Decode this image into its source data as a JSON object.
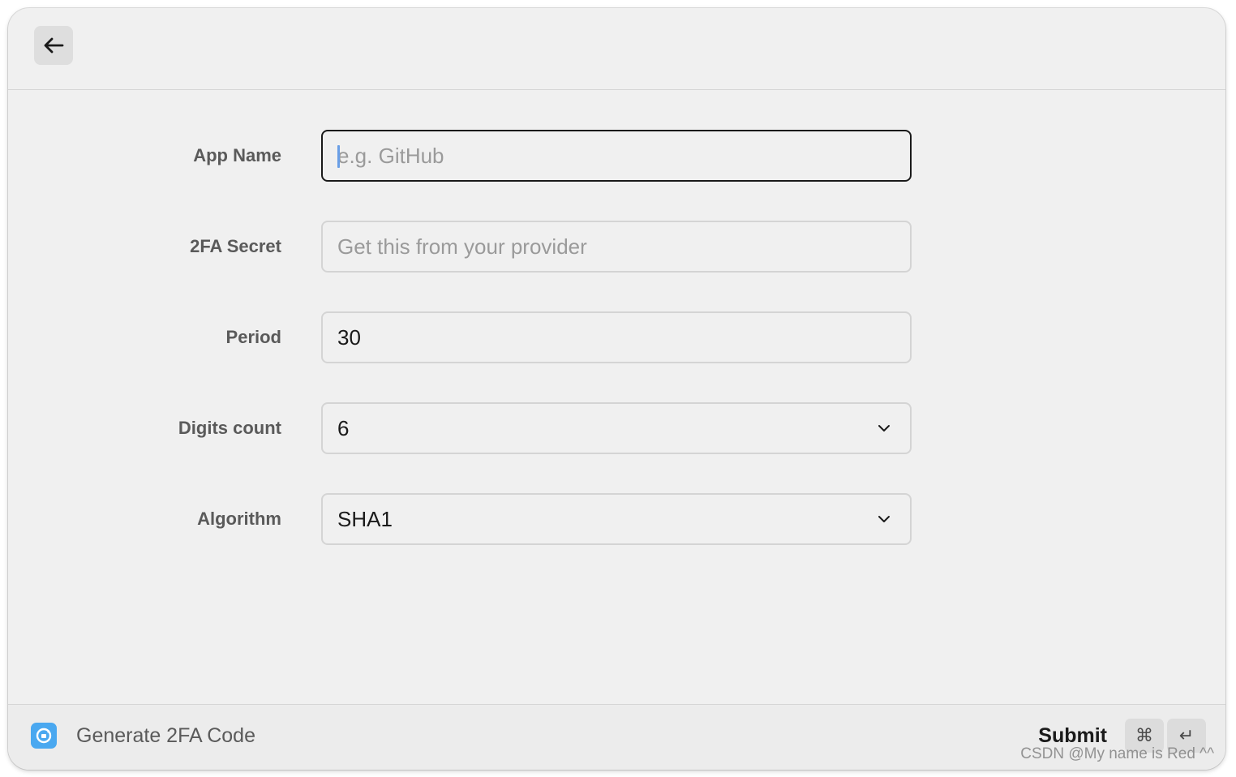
{
  "header": {
    "back_icon": "arrow-left-icon"
  },
  "form": {
    "app_name": {
      "label": "App Name",
      "placeholder": "e.g. GitHub",
      "value": ""
    },
    "secret": {
      "label": "2FA Secret",
      "placeholder": "Get this from your provider",
      "value": ""
    },
    "period": {
      "label": "Period",
      "value": "30"
    },
    "digits": {
      "label": "Digits count",
      "value": "6"
    },
    "algorithm": {
      "label": "Algorithm",
      "value": "SHA1"
    }
  },
  "footer": {
    "app_icon": "two-factor-app-icon",
    "title": "Generate 2FA Code",
    "submit_label": "Submit",
    "cmd_key": "⌘",
    "enter_key": "↵"
  },
  "watermark": "CSDN @My name is Red ^^",
  "colors": {
    "background": "#f0f0f0",
    "focus_border": "#1a1a1a",
    "caret": "#6a9fe6",
    "app_icon_bg": "#4aa8f0"
  }
}
